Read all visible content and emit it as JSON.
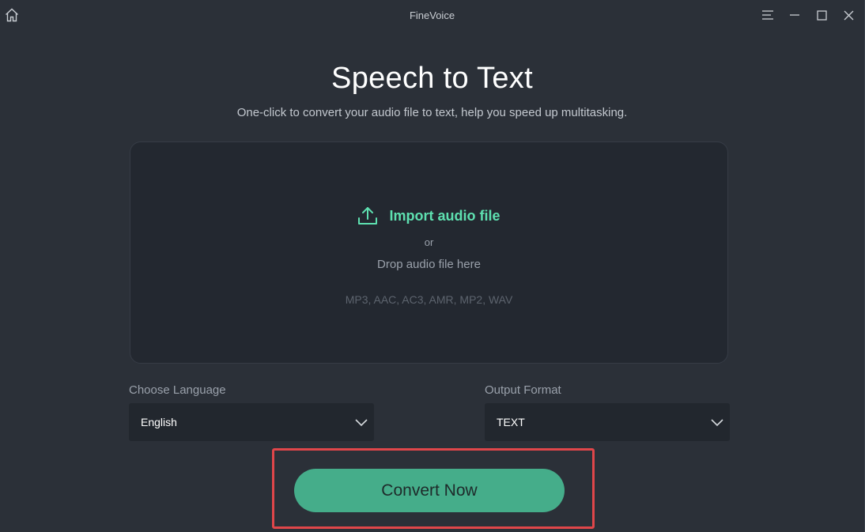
{
  "window": {
    "title": "FineVoice",
    "home_icon": "home-icon",
    "controls": [
      "menu-icon",
      "minimize-icon",
      "maximize-icon",
      "close-icon"
    ]
  },
  "header": {
    "title": "Speech to Text",
    "subtitle": "One-click to convert your audio file to text, help you speed up multitasking."
  },
  "dropzone": {
    "import_label": "Import audio file",
    "import_icon": "upload-icon",
    "or_text": "or",
    "drop_text": "Drop audio file here",
    "formats": "MP3, AAC, AC3, AMR, MP2, WAV"
  },
  "language": {
    "label": "Choose Language",
    "value": "English"
  },
  "output": {
    "label": "Output Format",
    "value": "TEXT"
  },
  "actions": {
    "convert_label": "Convert Now"
  },
  "colors": {
    "background": "#2b3038",
    "accent": "#5ee0b0",
    "button": "#45ad8a",
    "highlight": "#e0464a"
  }
}
